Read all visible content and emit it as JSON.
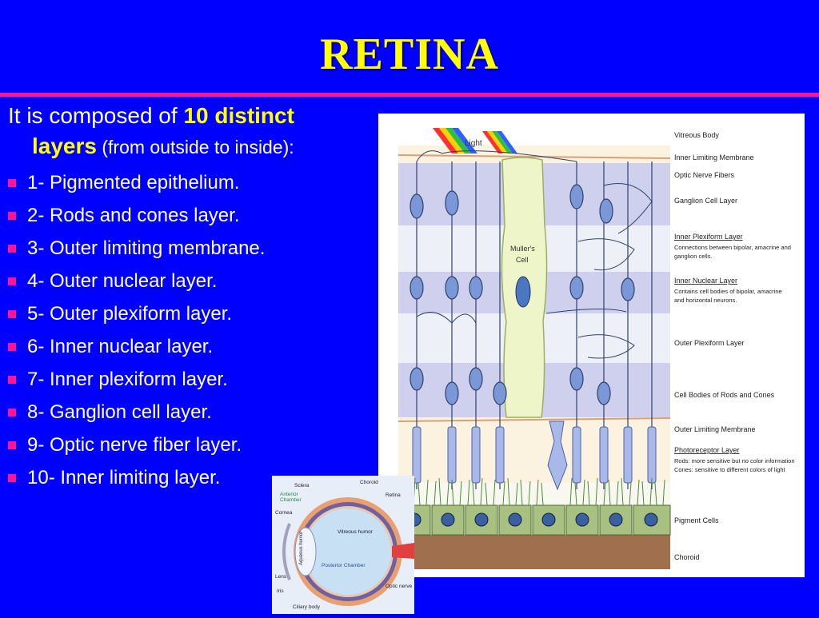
{
  "slide": {
    "title": "RETINA",
    "intro": {
      "prefix": "It is composed of ",
      "highlight_a": "10 distinct",
      "highlight_b": "layers",
      "suffix": " (from outside to inside):"
    },
    "layers": [
      "1- Pigmented epithelium.",
      "2- Rods and cones layer.",
      "3- Outer limiting membrane.",
      "4- Outer nuclear layer.",
      "5- Outer plexiform layer.",
      "6- Inner nuclear layer.",
      "7- Inner plexiform layer.",
      "8- Ganglion cell layer.",
      "9- Optic nerve fiber layer.",
      "10- Inner limiting layer."
    ],
    "colors": {
      "background": "#0000ff",
      "title": "#ffff00",
      "rule": "#ff1493",
      "bullet": "#ff1493",
      "text": "#ffffff"
    }
  },
  "diagram": {
    "light_label": "Light",
    "muller_label_1": "Muller's",
    "muller_label_2": "Cell",
    "labels": {
      "vitreous": "Vitreous Body",
      "ilm": "Inner Limiting Membrane",
      "onf": "Optic Nerve Fibers",
      "gcl": "Ganglion Cell Layer",
      "ipl": "Inner Plexiform Layer",
      "ipl_d1": "Connections between bipolar, amacrine and",
      "ipl_d2": "ganglion cells.",
      "inl": "Inner Nuclear Layer",
      "inl_d1": "Contains cell bodies of bipolar, amacrine",
      "inl_d2": "and horizontal neurons.",
      "opl": "Outer Plexiform Layer",
      "onl": "Cell Bodies of Rods and Cones",
      "olm": "Outer Limiting Membrane",
      "pr": "Photoreceptor Layer",
      "pr_d1": "Rods: more sensitive but no color information",
      "pr_d2": "Cones: sensitive to different colors of light",
      "pigment": "Pigment Cells",
      "choroid": "Choroid"
    }
  },
  "eye": {
    "labels": {
      "sclera": "Sclera",
      "choroid": "Choroid",
      "anterior_1": "Anterior",
      "anterior_2": "Chamber",
      "retina": "Retina",
      "cornea": "Cornea",
      "vitreous": "Vitreous humor",
      "aqueous": "Aqueous humor",
      "posterior": "Posterior Chamber",
      "lens": "Lens",
      "iris": "Iris",
      "optic": "Optic nerve",
      "ciliary": "Ciliary body"
    }
  }
}
